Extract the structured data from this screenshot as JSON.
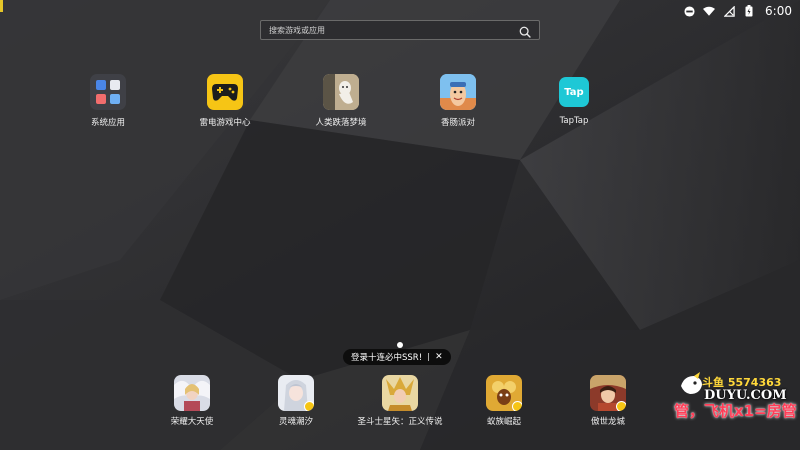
{
  "status_bar": {
    "time": "6:00",
    "icons": [
      "do-not-disturb-icon",
      "wifi-icon",
      "cellular-off-icon",
      "battery-icon"
    ]
  },
  "search": {
    "placeholder": "搜索游戏或应用",
    "icon": "search-icon"
  },
  "apps": [
    {
      "label": "系统应用",
      "icon": "system-apps-folder-icon"
    },
    {
      "label": "雷电游戏中心",
      "icon": "gamepad-icon"
    },
    {
      "label": "人类跌落梦境",
      "icon": "human-fall-flat-icon"
    },
    {
      "label": "香肠派对",
      "icon": "sausage-party-icon"
    },
    {
      "label": "TapTap",
      "icon": "taptap-icon",
      "tile_text": "Tap"
    }
  ],
  "dock": [
    {
      "label": "荣耀大天使",
      "icon": "game-icon-angel"
    },
    {
      "label": "灵魂潮汐",
      "icon": "game-icon-anime-girl"
    },
    {
      "label": "圣斗士星矢：正义传说",
      "icon": "game-icon-saint-seiya"
    },
    {
      "label": "蚁族崛起",
      "icon": "game-icon-ant"
    },
    {
      "label": "傲世龙城",
      "icon": "game-icon-dragon-city"
    }
  ],
  "toast": {
    "text": "登录十连必中SSR!",
    "close": "✕"
  },
  "watermark": {
    "brand": "斗鱼 5574363",
    "domain": "DUYU.COM",
    "fan_text": "管，飞机x1=房管"
  },
  "colors": {
    "accent_yellow": "#f6c515",
    "taptap": "#1ec8d6",
    "watermark_red": "#ff3d57"
  }
}
